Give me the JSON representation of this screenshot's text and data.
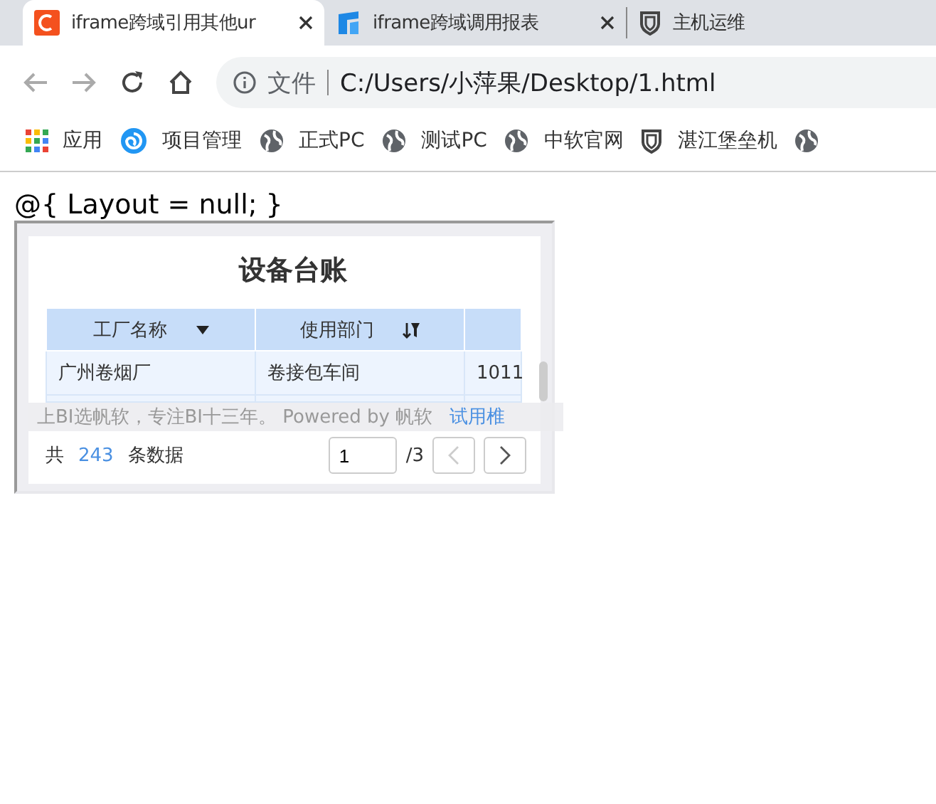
{
  "tabs": [
    {
      "title": "iframe跨域引用其他ur",
      "selected": true,
      "closable": true
    },
    {
      "title": "iframe跨域调用报表",
      "selected": false,
      "closable": true
    },
    {
      "title": "主机运维",
      "selected": false,
      "closable": false
    }
  ],
  "address": {
    "scheme_label": "文件",
    "url": "C:/Users/小萍果/Desktop/1.html"
  },
  "bookmarks": [
    {
      "label": "应用"
    },
    {
      "label": "项目管理"
    },
    {
      "label": "正式PC"
    },
    {
      "label": "测试PC"
    },
    {
      "label": "中软官网"
    },
    {
      "label": "湛江堡垒机"
    }
  ],
  "page_text": "@{ Layout = null; }",
  "report": {
    "title": "设备台账",
    "columns": [
      {
        "label": "工厂名称"
      },
      {
        "label": "使用部门"
      }
    ],
    "rows": [
      [
        "广州卷烟厂",
        "卷接包车间",
        "1011"
      ]
    ],
    "footer": {
      "prefix": "共",
      "count": "243",
      "suffix": "条数据",
      "page": "1",
      "pages": "/3"
    },
    "banner": {
      "text": "上BI选帆软，专注BI十三年。 Powered by 帆软",
      "link": "试用椎"
    }
  }
}
